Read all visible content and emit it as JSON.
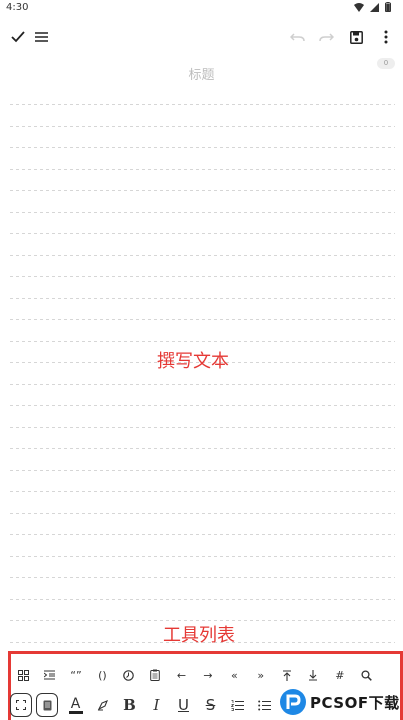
{
  "status_bar": {
    "time": "4:30"
  },
  "editor": {
    "title_placeholder": "标题",
    "char_count": "0"
  },
  "annotations": {
    "write_text": "撰写文本",
    "tool_list": "工具列表"
  },
  "tools_row1": [
    "grid",
    "indent",
    "“”",
    "()",
    "clock",
    "clipboard",
    "←",
    "→",
    "«",
    "»",
    "top",
    "bottom",
    "#",
    "search"
  ],
  "tools_row2": [
    "fullscreen",
    "document",
    "A",
    "brush",
    "B",
    "I",
    "U",
    "S",
    "ordered-list",
    "bullet-list"
  ],
  "watermark": {
    "text": "PCSOF下载"
  },
  "colors": {
    "accent": "#e53935",
    "text_color_bar": "#222222"
  }
}
